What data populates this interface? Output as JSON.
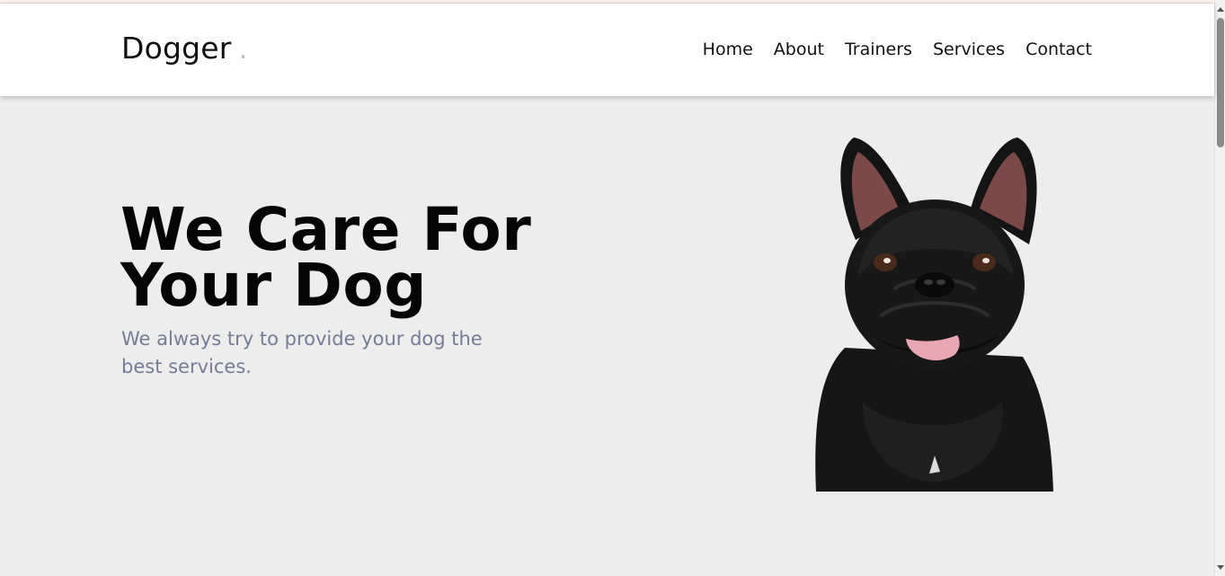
{
  "navbar": {
    "brand": "Dogger",
    "brand_dot": ".",
    "links": [
      "Home",
      "About",
      "Trainers",
      "Services",
      "Contact"
    ]
  },
  "hero": {
    "title_line1": "We Care For",
    "title_line2": "Your Dog",
    "subtitle": "We always try to provide your dog the best services.",
    "image": "black-french-bulldog-photo"
  },
  "colors": {
    "hero_background": "#ededed",
    "subtitle": "#767b96",
    "brand_dot": "#b8bcc8"
  }
}
